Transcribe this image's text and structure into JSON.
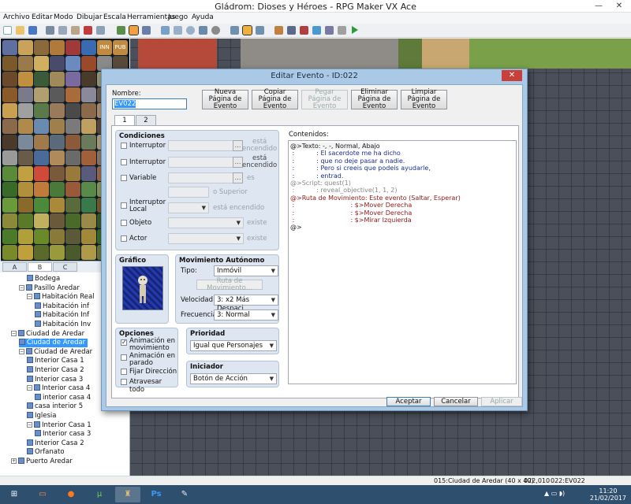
{
  "window": {
    "title": "Gládrom: Dioses y Héroes - RPG Maker VX Ace"
  },
  "menu": [
    "Archivo",
    "Editar",
    "Modo",
    "Dibujar",
    "Escala",
    "Herramientas",
    "Juego",
    "Ayuda"
  ],
  "tile_tabs": [
    "A",
    "B",
    "C"
  ],
  "tile_pal_labels": [
    "INN",
    "PUB"
  ],
  "map_tree": [
    {
      "label": "Bodega",
      "indent": 3,
      "toggle": ""
    },
    {
      "label": "Pasillo Aredar",
      "indent": 2,
      "toggle": "−"
    },
    {
      "label": "Habitación Real",
      "indent": 3,
      "toggle": "−"
    },
    {
      "label": "Habitación inf",
      "indent": 4,
      "toggle": ""
    },
    {
      "label": "Habitación Inf",
      "indent": 4,
      "toggle": ""
    },
    {
      "label": "Habitación Inv",
      "indent": 4,
      "toggle": ""
    },
    {
      "label": "Ciudad de Aredar",
      "indent": 1,
      "toggle": "−"
    },
    {
      "label": "Ciudad de Aredar",
      "indent": 2,
      "toggle": "",
      "selected": true
    },
    {
      "label": "Ciudad de Aredar",
      "indent": 2,
      "toggle": "−"
    },
    {
      "label": "Interior Casa 1",
      "indent": 3,
      "toggle": ""
    },
    {
      "label": "Interior Casa 2",
      "indent": 3,
      "toggle": ""
    },
    {
      "label": "Interior casa 3",
      "indent": 3,
      "toggle": ""
    },
    {
      "label": "Interior casa 4",
      "indent": 3,
      "toggle": "−"
    },
    {
      "label": "interior casa 4",
      "indent": 4,
      "toggle": ""
    },
    {
      "label": "casa interior 5",
      "indent": 3,
      "toggle": ""
    },
    {
      "label": "Iglesia",
      "indent": 3,
      "toggle": ""
    },
    {
      "label": "Interior Casa 1",
      "indent": 3,
      "toggle": "−"
    },
    {
      "label": "Interior casa 3",
      "indent": 4,
      "toggle": ""
    },
    {
      "label": "Interior Casa 2",
      "indent": 3,
      "toggle": ""
    },
    {
      "label": "Orfanato",
      "indent": 3,
      "toggle": ""
    },
    {
      "label": "Puerto Aredar",
      "indent": 1,
      "toggle": "+"
    }
  ],
  "status": {
    "map": "015:Ciudad de Aredar (40 x 40)",
    "coord": "022,010",
    "event": "022:EV022"
  },
  "clock": {
    "time": "11:20",
    "date": "21/02/2017"
  },
  "dialog": {
    "title": "Editar Evento - ID:022",
    "close": "✕",
    "name_label": "Nombre:",
    "name_value": "EV022",
    "buttons": {
      "new_page": "Nueva\nPágina de\nEvento",
      "copy_page": "Copiar\nPágina de\nEvento",
      "paste_page": "Pegar\nPágina de\nEvento",
      "delete_page": "Eliminar\nPágina de\nEvento",
      "clear_page": "Limpiar\nPágina de\nEvento"
    },
    "tabs": [
      "1",
      "2"
    ],
    "conditions": {
      "title": "Condiciones",
      "switch1": "Interruptor",
      "switch2": "Interruptor",
      "variable": "Variable",
      "local_switch": "Interruptor\nLocal",
      "item": "Objeto",
      "actor": "Actor",
      "is_on": "está\nencendido",
      "is": "es",
      "or_higher": "o Superior",
      "is_on_single": "está encendido",
      "exists": "existe"
    },
    "graphic": {
      "title": "Gráfico"
    },
    "autonomous": {
      "title": "Movimiento Autónomo",
      "type_label": "Tipo:",
      "type_value": "Inmóvil",
      "route_button": "Ruta de Movimiento...",
      "speed_label": "Velocidad:",
      "speed_value": "3: x2 Más Despaci",
      "freq_label": "Frecuencia:",
      "freq_value": "3: Normal"
    },
    "options": {
      "title": "Opciones",
      "walk_anim": "Animación en\nmovimiento",
      "step_anim": "Animación en\nparado",
      "fixed_dir": "Fijar Dirección",
      "through": "Atravesar todo"
    },
    "priority": {
      "title": "Prioridad",
      "value": "Igual que Personajes"
    },
    "trigger": {
      "title": "Iniciador",
      "value": "Botón de Acción"
    },
    "contents_label": "Contenidos:",
    "contents": [
      {
        "text": "@>Texto: -, -, Normal, Abajo",
        "color": "#1a1a1a",
        "gray": "-, -, Normal, Abajo"
      },
      {
        "text": " :           : El sacerdote me ha dicho",
        "color": "#1c2f8c"
      },
      {
        "text": " :           : que no deje pasar a nadie.",
        "color": "#1c2f8c"
      },
      {
        "text": " :           : Pero si creeis que podeis ayudarle,",
        "color": "#1c2f8c"
      },
      {
        "text": " :           : entrad.",
        "color": "#1c2f8c"
      },
      {
        "text": "@>Script: quest(1)",
        "color": "#888888"
      },
      {
        "text": " :           : reveal_objective(1, 1, 2)",
        "color": "#888888"
      },
      {
        "text": "@>Ruta de Movimiento: Este evento (Saltar, Esperar)",
        "color": "#8b1a1a"
      },
      {
        "text": " :                            : $>Mover Derecha",
        "color": "#8b1a1a"
      },
      {
        "text": " :                            : $>Mover Derecha",
        "color": "#8b1a1a"
      },
      {
        "text": " :                            : $>Mirar Izquierda",
        "color": "#8b1a1a"
      },
      {
        "text": "@>",
        "color": "#1a1a1a"
      }
    ],
    "footer": {
      "ok": "Aceptar",
      "cancel": "Cancelar",
      "apply": "Aplicar"
    }
  }
}
